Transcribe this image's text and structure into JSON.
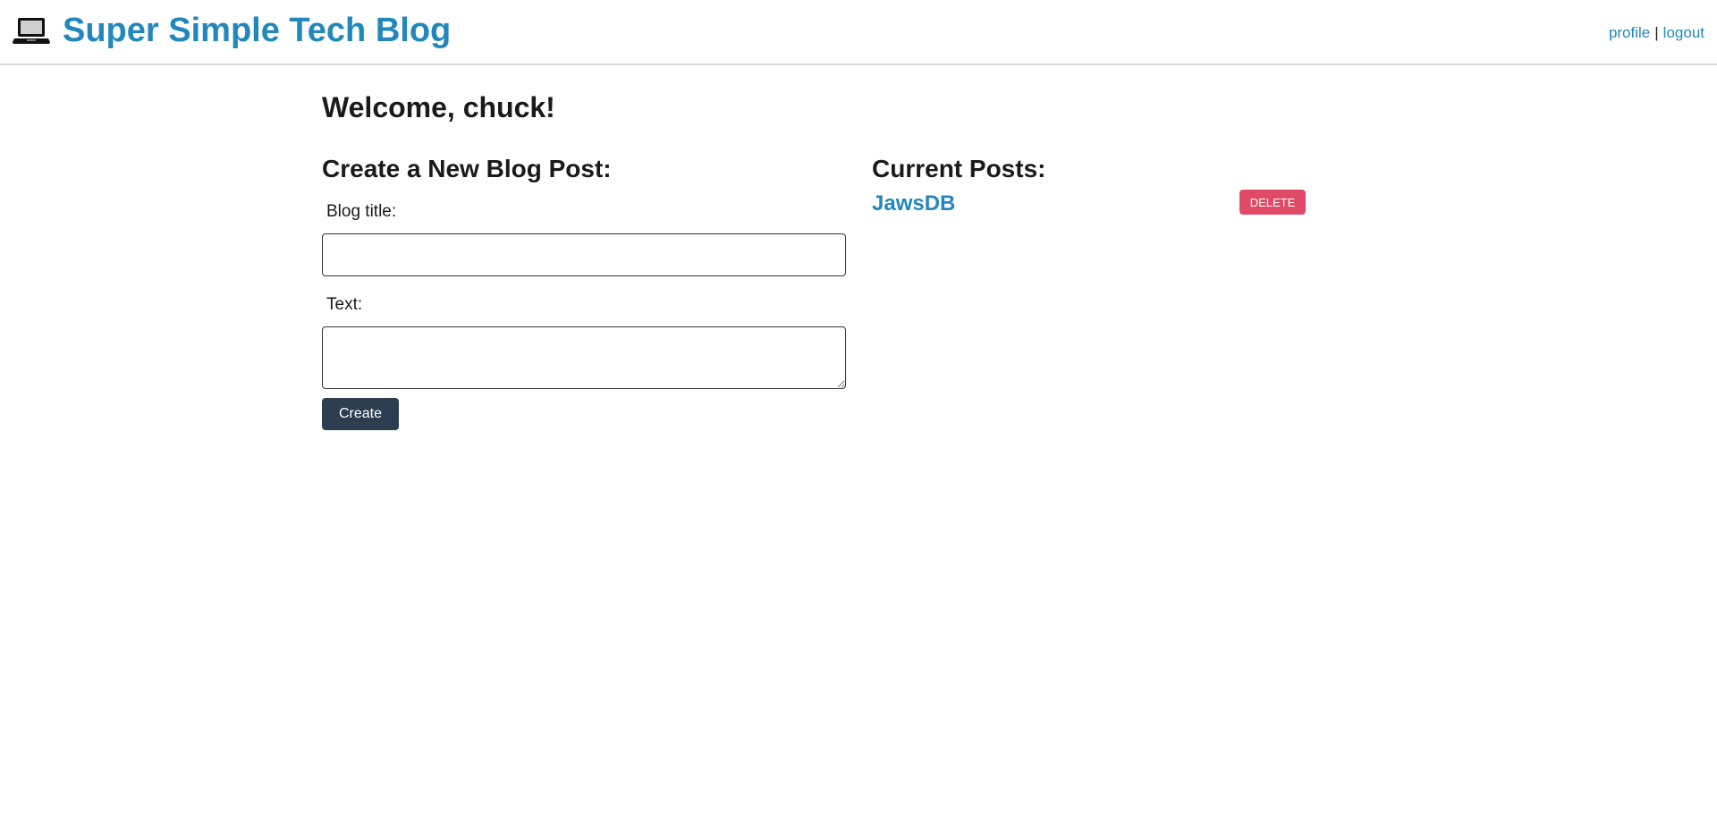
{
  "header": {
    "site_title": "Super Simple Tech Blog",
    "logo_icon": "laptop-icon",
    "nav": {
      "profile": "profile",
      "separator": "|",
      "logout": "logout"
    }
  },
  "welcome": "Welcome, chuck!",
  "create_form": {
    "heading": "Create a New Blog Post:",
    "title_label": "Blog title:",
    "title_value": "",
    "text_label": "Text:",
    "text_value": "",
    "submit_label": "Create"
  },
  "current_posts": {
    "heading": "Current Posts:",
    "posts": [
      {
        "title": "JawsDB",
        "delete_label": "DELETE"
      }
    ]
  },
  "colors": {
    "brand": "#2288bb",
    "primary_button": "#2c3e50",
    "danger_button": "#e04a66"
  }
}
